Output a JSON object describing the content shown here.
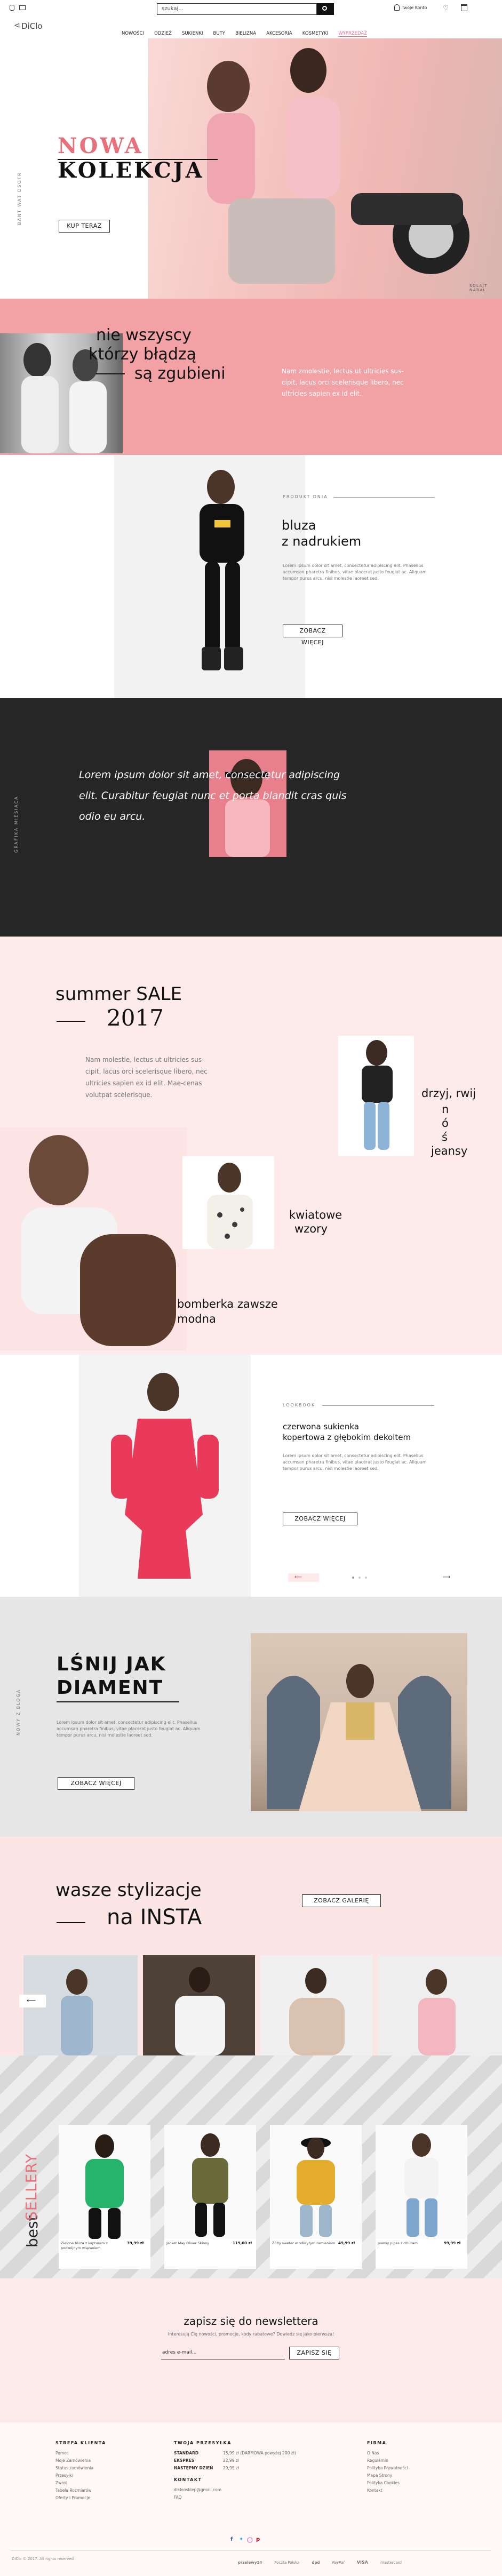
{
  "header": {
    "logo": "DiClo",
    "search_placeholder": "szukaj...",
    "account_label": "Twoje Konto",
    "nav": [
      "NOWOŚCI",
      "ODZIEŻ",
      "SUKIENKI",
      "BUTY",
      "BIELIZNA",
      "AKCESORIA",
      "KOSMETYKI",
      "WYPRZEDAŻ"
    ]
  },
  "hero": {
    "side_label": "BANT WAT DSOFR",
    "title_line1": "NOWA",
    "title_line2": "KOLEKCJA",
    "cta": "KUP TERAZ",
    "corner_label": "SOLAJT NABAL"
  },
  "quote": {
    "line1": "nie wszyscy",
    "line2": "którzy błądzą",
    "line3": "są zgubieni",
    "text": "Nam zmolestie, lectus ut ultricies sus-cipit, lacus orci scelerisque libero, nec ultricies sapien ex id elit."
  },
  "product1": {
    "label": "PRODUKT DNIA",
    "title_line1": "bluza",
    "title_line2": "z nadrukiem",
    "text": "Lorem ipsum dolor sit amet, consectetur adipiscing elit. Phasellus accumsan pharetra finibus, vitae placerat justo feugiat ac. Aliquam tempor purus arcu, nisl molestie laoreet sed.",
    "cta": "ZOBACZ WIĘCEJ"
  },
  "dark": {
    "side_label": "GRAFIKA MIESIĄCA",
    "text": "Lorem ipsum dolor sit amet, consectetur adipiscing elit. Curabitur feugiat nunc et porta blandit cras quis odio eu arcu."
  },
  "sale": {
    "title_line1": "summer SALE",
    "title_line2": "2017",
    "text": "Nam molestie, lectus ut ultricies sus-cipit, lacus orci scelerisque libero, nec ultricies sapien ex id elit. Mae-cenas volutpat scelerisque.",
    "item1": [
      "drzyj, rwij",
      "n",
      "ó",
      "ś",
      "jeansy"
    ],
    "item2": [
      "kwiatowe",
      "wzory"
    ],
    "item3": [
      "bomberka zawsze",
      "modna"
    ]
  },
  "product2": {
    "label": "LOOKBOOK",
    "title_line1": "czerwona sukienka",
    "title_line2": "kopertowa z głębokim dekoltem",
    "text": "Lorem ipsum dolor sit amet, consectetur adipiscing elit. Phasellus accumsan pharetra finibus, vitae placerat justo feugiat ac. Aliquam tempor purus arcu, nisl molestie laoreet sed.",
    "cta": "ZOBACZ WIĘCEJ"
  },
  "diamond": {
    "side_label": "NOWY Z BLOGA",
    "title_line1": "LŚNIJ JAK",
    "title_line2": "DIAMENT",
    "text": "Lorem ipsum dolor sit amet, consectetur adipiscing elit. Phasellus accumsan pharetra finibus, vitae placerat justo feugiat ac. Aliquam tempor purus arcu, nisl molestie laoreet sed.",
    "cta": "ZOBACZ WIĘCEJ"
  },
  "insta": {
    "title_line1": "wasze stylizacje",
    "title_line2": "na INSTA",
    "cta": "ZOBACZ GALERIĘ"
  },
  "best": {
    "title_line1": "best",
    "title_line2": "SELLERY",
    "products": [
      {
        "name": "Zielona bluza z kapturem z podwójnym wiązaniem",
        "price": "39,99 zł"
      },
      {
        "name": "Jacket May Oliver Skinny",
        "price": "119,00 zł"
      },
      {
        "name": "Żółty sweter w odkrytym ramieniem",
        "price": "49,99 zł"
      },
      {
        "name": "Jeansy pipes z dziurami",
        "price": "99,99 zł"
      }
    ]
  },
  "newsletter": {
    "title": "zapisz się do newslettera",
    "subtitle": "Interesują Cię nowości, promocje, kody rabatowe? Dowiedz się jako pierwsza!",
    "placeholder": "adres e-mail...",
    "cta": "ZAPISZ SIĘ"
  },
  "footer": {
    "col1_title": "STREFA KLIENTA",
    "col1_items": [
      "Pomoc",
      "Moje Zamówienia",
      "Status zamówienia",
      "Przesyłki",
      "Zwrot",
      "Tabela Rozmiarów",
      "Oferty i Promocje"
    ],
    "col2_title": "TWOJA PRZESYŁKA",
    "col2_rows": [
      [
        "STANDARD",
        "15,99 zł (DARMOWA powyżej 200 zł)"
      ],
      [
        "EKSPRES",
        "22,99 zł"
      ],
      [
        "NASTĘPNY DZIEŃ",
        "29,99 zł"
      ]
    ],
    "col2_contact_title": "KONTAKT",
    "col2_email": "diklonsklep@gmail.com",
    "col2_faq": "FAQ",
    "col3_title": "FIRMA",
    "col3_items": [
      "O Nas",
      "Regulamin",
      "Polityka Prywatności",
      "Mapa Strony",
      "Polityka Cookies",
      "Kontakt"
    ],
    "copyright": "DiClo © 2017. All rights reserved",
    "payments": [
      "przelewy24",
      "Poczta Polska",
      "dpd",
      "PayPal",
      "VISA",
      "mastercard"
    ]
  },
  "colors": {
    "pink": "#f2a1a4",
    "light_pink": "#fdeaea",
    "dark": "#262626",
    "grey": "#e8e8e8"
  }
}
